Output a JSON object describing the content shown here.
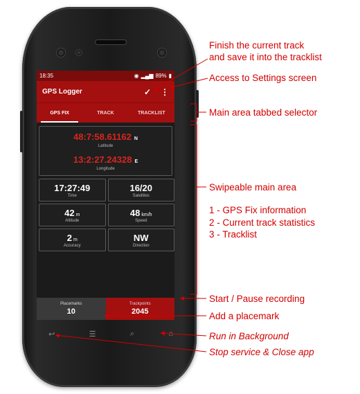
{
  "status_bar": {
    "time": "18:35",
    "battery": "89%"
  },
  "app_bar": {
    "title": "GPS Logger",
    "check_icon": "check-icon",
    "menu_icon": "more-vert-icon"
  },
  "tabs": [
    {
      "label": "GPS FIX",
      "active": true
    },
    {
      "label": "TRACK",
      "active": false
    },
    {
      "label": "TRACKLIST",
      "active": false
    }
  ],
  "gps": {
    "latitude": {
      "value": "48:7:58.61162",
      "hemisphere": "N",
      "label": "Latitude"
    },
    "longitude": {
      "value": "13:2:27.24328",
      "hemisphere": "E",
      "label": "Longitude"
    },
    "cells": [
      {
        "value": "17:27:49",
        "unit": "",
        "label": "Time"
      },
      {
        "value": "16/20",
        "unit": "",
        "label": "Satellites"
      },
      {
        "value": "42",
        "unit": "m",
        "label": "Altitude"
      },
      {
        "value": "48",
        "unit": "km/h",
        "label": "Speed"
      },
      {
        "value": "2",
        "unit": "m",
        "label": "Accuracy"
      },
      {
        "value": "NW",
        "unit": "",
        "label": "Direction"
      }
    ]
  },
  "bottom_bar": {
    "placemarks": {
      "label": "Placemarks",
      "count": "10"
    },
    "trackpoints": {
      "label": "Trackpoints",
      "count": "2045"
    }
  },
  "annotations": {
    "finish": "Finish the current track",
    "finish2": "and save it into the tracklist",
    "settings": "Access to Settings screen",
    "tabbed": "Main area tabbed selector",
    "swipe": "Swipeable main area",
    "item1": "1 - GPS Fix information",
    "item2": "2 - Current track statistics",
    "item3": "3 - Tracklist",
    "start": "Start / Pause recording",
    "placemark": "Add a placemark",
    "background": "Run in Background",
    "stop": "Stop service & Close app"
  },
  "colors": {
    "accent": "#a40f0f",
    "annotation": "#d20000",
    "coord": "#d7261e"
  }
}
